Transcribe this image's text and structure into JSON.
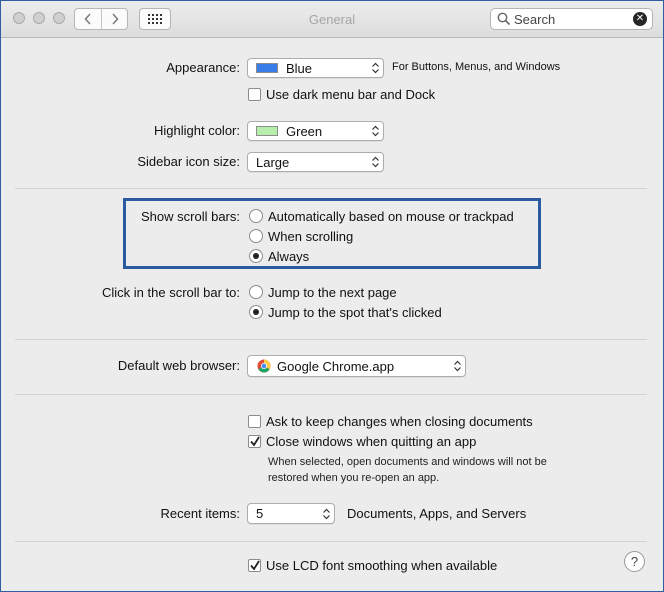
{
  "window": {
    "title": "General"
  },
  "toolbar": {
    "search_placeholder": "Search"
  },
  "appearance": {
    "label": "Appearance:",
    "value": "Blue",
    "swatch_color": "#3b7de8",
    "note": "For Buttons, Menus, and Windows",
    "dark_menu_label": "Use dark menu bar and Dock",
    "dark_menu_checked": false
  },
  "highlight": {
    "label": "Highlight color:",
    "value": "Green",
    "swatch_color": "#b8eeab"
  },
  "sidebar_icon": {
    "label": "Sidebar icon size:",
    "value": "Large"
  },
  "scroll_bars": {
    "label": "Show scroll bars:",
    "options": [
      "Automatically based on mouse or trackpad",
      "When scrolling",
      "Always"
    ],
    "selected": "Always"
  },
  "click_scroll": {
    "label": "Click in the scroll bar to:",
    "options": [
      "Jump to the next page",
      "Jump to the spot that's clicked"
    ],
    "selected": "Jump to the spot that's clicked"
  },
  "browser": {
    "label": "Default web browser:",
    "value": "Google Chrome.app"
  },
  "documents": {
    "ask_keep_label": "Ask to keep changes when closing documents",
    "ask_keep_checked": false,
    "close_windows_label": "Close windows when quitting an app",
    "close_windows_checked": true,
    "note_line1": "When selected, open documents and windows will not be",
    "note_line2": "restored when you re-open an app."
  },
  "recent": {
    "label": "Recent items:",
    "value": "5",
    "suffix": "Documents, Apps, and Servers"
  },
  "lcd": {
    "label": "Use LCD font smoothing when available",
    "checked": true
  },
  "help": {
    "label": "?"
  },
  "colors": {
    "highlight_border": "#2a5ba0",
    "window_bg": "#ececec"
  }
}
